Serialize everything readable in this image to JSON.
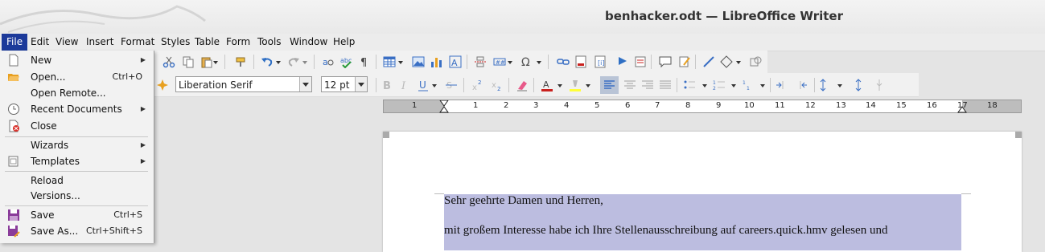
{
  "window": {
    "title": "benhacker.odt — LibreOffice Writer"
  },
  "menubar": {
    "items": [
      "File",
      "Edit",
      "View",
      "Insert",
      "Format",
      "Styles",
      "Table",
      "Form",
      "Tools",
      "Window",
      "Help"
    ]
  },
  "file_menu": {
    "items": [
      {
        "label": "New",
        "shortcut": "",
        "submenu": true,
        "icon": "new-document-icon"
      },
      {
        "label": "Open...",
        "shortcut": "Ctrl+O",
        "submenu": false,
        "icon": "open-folder-icon"
      },
      {
        "label": "Open Remote...",
        "shortcut": "",
        "submenu": false,
        "icon": ""
      },
      {
        "label": "Recent Documents",
        "shortcut": "",
        "submenu": true,
        "icon": "recent-documents-icon"
      },
      {
        "label": "Close",
        "shortcut": "",
        "submenu": false,
        "icon": "close-document-icon"
      },
      {
        "label": "Wizards",
        "shortcut": "",
        "submenu": true,
        "icon": ""
      },
      {
        "label": "Templates",
        "shortcut": "",
        "submenu": true,
        "icon": "templates-icon"
      },
      {
        "label": "Reload",
        "shortcut": "",
        "submenu": false,
        "icon": ""
      },
      {
        "label": "Versions...",
        "shortcut": "",
        "submenu": false,
        "icon": ""
      },
      {
        "label": "Save",
        "shortcut": "Ctrl+S",
        "submenu": false,
        "icon": "save-icon"
      },
      {
        "label": "Save As...",
        "shortcut": "Ctrl+Shift+S",
        "submenu": false,
        "icon": "save-as-icon"
      }
    ]
  },
  "formatting": {
    "font_name": "Liberation Serif",
    "font_size": "12 pt"
  },
  "ruler": {
    "labels": [
      "1",
      "1",
      "2",
      "3",
      "4",
      "5",
      "6",
      "7",
      "8",
      "9",
      "10",
      "11",
      "12",
      "13",
      "14",
      "15",
      "16",
      "17",
      "18"
    ]
  },
  "document": {
    "line1": "Sehr geehrte Damen und Herren,",
    "line2": "mit großem Interesse habe ich Ihre Stellenausschreibung auf careers.quick.hmv gelesen und"
  },
  "colors": {
    "menu_highlight": "#1c3a9a",
    "selection": "#bcbde0",
    "font_color_bar": "#c9211e",
    "highlight_bar": "#ffff38"
  }
}
